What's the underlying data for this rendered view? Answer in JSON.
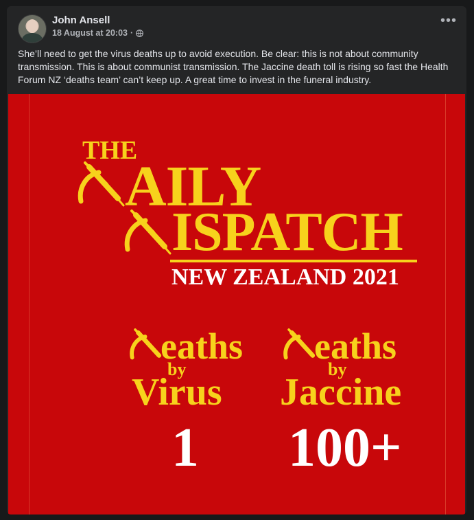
{
  "post": {
    "author": "John Ansell",
    "date": "18 August at 20:03",
    "separator": "·",
    "privacy_icon": "globe-icon",
    "more_label": "•••",
    "text": "She’ll need to get the virus deaths up to avoid execution. Be clear: this is not about community transmission. This is about communist transmission. The Jaccine death toll is rising so fast the Health Forum NZ ‘deaths team’ can’t keep up. A great time to invest in the funeral industry."
  },
  "image": {
    "background_color": "#c8070a",
    "accent_color": "#f7d21c",
    "title_the": "THE",
    "title_line1": "AILY",
    "title_line2": "ISPATCH",
    "subtitle": "NEW ZEALAND 2021",
    "left": {
      "word1": "eaths",
      "word2": "by",
      "word3": "Virus",
      "value": "1"
    },
    "right": {
      "word1": "eaths",
      "word2": "by",
      "word3": "Jaccine",
      "value": "100+"
    },
    "icons": [
      "hammer-sickle-syringe-icon"
    ]
  }
}
